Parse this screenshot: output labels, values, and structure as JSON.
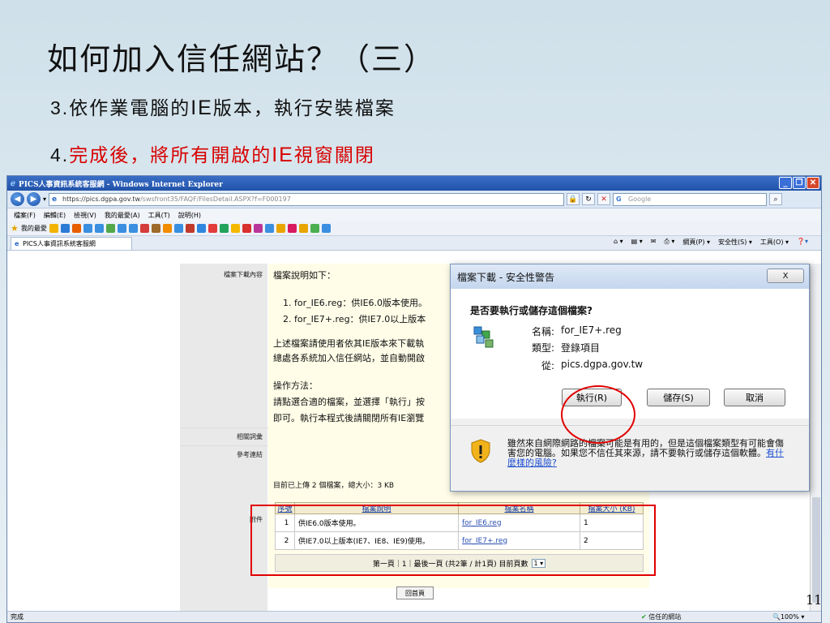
{
  "slide": {
    "title": "如何加入信任網站？（三）",
    "step3_num": "3.",
    "step3_a": "依作業電腦的",
    "step3_ie": "IE",
    "step3_b": "版本，執行安裝檔案",
    "step4_num": "4.",
    "step4_a": "完成後，將所有開啟的",
    "step4_ie": "IE",
    "step4_b": "視窗關閉",
    "page_number": "11"
  },
  "browser": {
    "title": "PICS人事資訊系統客服網 - Windows Internet Explorer",
    "url_host": "https://pics.dgpa.gov.tw",
    "url_path": "/swsfront35/FAQF/FilesDetail.ASPX?f=F000197",
    "search_placeholder": "Google",
    "menu": [
      "檔案(F)",
      "編輯(E)",
      "檢視(V)",
      "我的最愛(A)",
      "工具(T)",
      "說明(H)"
    ],
    "favorites_label": "我的最愛",
    "tab_label": "PICS人事資訊系統客服網",
    "command_items": [
      "網頁(P) ▾",
      "安全性(S) ▾",
      "工具(O) ▾"
    ],
    "status_left": "完成",
    "status_zone": "信任的網站",
    "status_zoom": "100%"
  },
  "page": {
    "label_download": "檔案下載內容",
    "label_related": "相關詞彙",
    "label_reference": "參考連結",
    "label_attach": "附件",
    "desc_heading": "檔案說明如下：",
    "desc_item1": "1.  for_IE6.reg：供IE6.0版本使用。",
    "desc_item2": "2.  for_IE7+.reg：供IE7.0以上版本",
    "desc_para1": "上述檔案請使用者依其IE版本來下載執",
    "desc_para2": "總處各系統加入信任網站，並自動開啟",
    "method_heading": "操作方法：",
    "method_1": "請點選合適的檔案，並選擇「執行」按",
    "method_2": "即可。執行本程式後請關閉所有IE瀏覽",
    "upload_summary": "目前已上傳 2 個檔案，總大小：3 KB",
    "table_headers": [
      "序號",
      "檔案說明",
      "檔案名稱",
      "檔案大小 (KB)"
    ],
    "table_rows": [
      [
        "1",
        "供IE6.0版本使用。",
        "for_IE6.reg",
        "1"
      ],
      [
        "2",
        "供IE7.0以上版本(IE7、IE8、IE9)使用。",
        "for_IE7+.reg",
        "2"
      ]
    ],
    "pager_text": "第一頁｜1｜最後一頁 (共2筆 / 計1頁) 目前頁數",
    "pager_value": "1",
    "home_button": "回首頁"
  },
  "dialog": {
    "title": "檔案下載 - 安全性警告",
    "close": "X",
    "question": "是否要執行或儲存這個檔案?",
    "name_label": "名稱:",
    "name_value": "for_IE7+.reg",
    "type_label": "類型:",
    "type_value": "登錄項目",
    "from_label": "從:",
    "from_value": "pics.dgpa.gov.tw",
    "run": "執行(R)",
    "save": "儲存(S)",
    "cancel": "取消",
    "warning": "雖然來自網際網路的檔案可能是有用的，但是這個檔案類型有可能會傷害您的電腦。如果您不信任其來源，請不要執行或儲存這個軟體。",
    "warning_link": "有什麼樣的風險?"
  },
  "colors": {
    "slide_red": "#d80000",
    "highlight": "#e10000",
    "link": "#2b4fb5"
  }
}
